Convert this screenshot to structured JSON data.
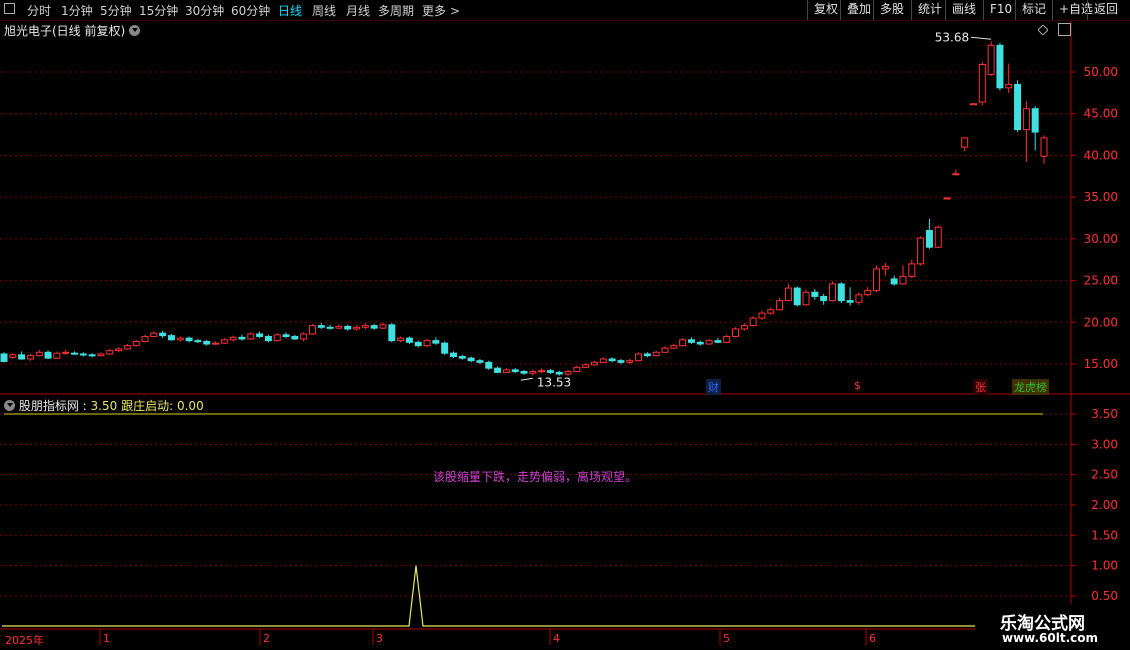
{
  "toolbar": {
    "periods": [
      "分时",
      "1分钟",
      "5分钟",
      "15分钟",
      "30分钟",
      "60分钟",
      "日线",
      "周线",
      "月线",
      "多周期",
      "更多 >"
    ],
    "active_period": "日线",
    "right_buttons": [
      "复权",
      "叠加",
      "多股",
      "统计",
      "画线",
      "F10",
      "标记",
      "+自选",
      "返回"
    ]
  },
  "main": {
    "title": "旭光电子(日线 前复权)",
    "high_label": "53.68",
    "low_label": "13.53",
    "markers": [
      {
        "text": "财",
        "color": "#3060ff"
      },
      {
        "text": "$",
        "color": "#ff3030"
      },
      {
        "text": "张",
        "color": "#ff3030"
      },
      {
        "text": "龙虎榜",
        "color": "#30c030"
      }
    ],
    "y_ticks": [
      "50.00",
      "45.00",
      "40.00",
      "35.00",
      "30.00",
      "25.00",
      "20.00",
      "15.00"
    ]
  },
  "indicator": {
    "name": "股朋指标网",
    "value1": "3.50",
    "label2": "跟庄启动",
    "value2": "0.00",
    "message": "该股缩量下跌，走势偏弱，离场观望。",
    "y_ticks": [
      "3.50",
      "3.00",
      "2.50",
      "2.00",
      "1.50",
      "1.00",
      "0.50"
    ]
  },
  "date_axis": [
    "2025年",
    "1",
    "2",
    "3",
    "4",
    "5",
    "6"
  ],
  "watermark": {
    "line1": "乐淘公式网",
    "line2": "www.60lt.com"
  },
  "colors": {
    "up": "#ff3030",
    "down": "#40e0e0",
    "grid": "#7a0000",
    "line": "#e0d000",
    "signal": "#e8e860"
  },
  "chart_data": {
    "type": "candlestick",
    "series_note": "",
    "high": 53.68,
    "low": 13.53,
    "price_ylim": [
      11,
      57
    ],
    "indicator_ylim": [
      0,
      3.75
    ],
    "candles": [
      [
        16.2,
        15.3,
        16.4,
        15.2
      ],
      [
        15.8,
        16.1,
        16.3,
        15.6
      ],
      [
        16.1,
        15.6,
        16.5,
        15.5
      ],
      [
        15.6,
        16.0,
        16.2,
        15.4
      ],
      [
        16.0,
        16.4,
        16.7,
        15.9
      ],
      [
        16.4,
        15.7,
        16.6,
        15.6
      ],
      [
        15.7,
        16.3,
        16.5,
        15.6
      ],
      [
        16.3,
        16.4,
        16.7,
        16.1
      ],
      [
        16.3,
        16.2,
        16.5,
        16.1
      ],
      [
        16.2,
        16.1,
        16.4,
        15.9
      ],
      [
        16.1,
        16.0,
        16.3,
        15.8
      ],
      [
        16.0,
        16.2,
        16.4,
        15.9
      ],
      [
        16.2,
        16.6,
        16.8,
        16.1
      ],
      [
        16.6,
        16.8,
        17.0,
        16.4
      ],
      [
        16.8,
        17.2,
        17.4,
        16.7
      ],
      [
        17.2,
        17.7,
        17.9,
        17.1
      ],
      [
        17.7,
        18.3,
        18.5,
        17.6
      ],
      [
        18.3,
        18.7,
        18.9,
        18.2
      ],
      [
        18.7,
        18.4,
        19.0,
        18.1
      ],
      [
        18.4,
        17.9,
        18.6,
        17.8
      ],
      [
        17.9,
        18.1,
        18.3,
        17.7
      ],
      [
        18.1,
        17.8,
        18.3,
        17.6
      ],
      [
        17.8,
        17.7,
        18.0,
        17.5
      ],
      [
        17.7,
        17.4,
        17.9,
        17.2
      ],
      [
        17.4,
        17.5,
        17.7,
        17.3
      ],
      [
        17.5,
        17.9,
        18.1,
        17.4
      ],
      [
        17.9,
        18.2,
        18.4,
        17.7
      ],
      [
        18.2,
        18.0,
        18.5,
        17.8
      ],
      [
        18.0,
        18.6,
        18.8,
        17.9
      ],
      [
        18.6,
        18.3,
        18.9,
        18.1
      ],
      [
        18.3,
        17.8,
        18.5,
        17.6
      ],
      [
        17.8,
        18.5,
        18.7,
        17.7
      ],
      [
        18.5,
        18.3,
        18.8,
        18.1
      ],
      [
        18.3,
        18.0,
        18.5,
        17.9
      ],
      [
        18.0,
        18.6,
        18.8,
        17.7
      ],
      [
        18.6,
        19.6,
        19.8,
        18.5
      ],
      [
        19.6,
        19.4,
        19.9,
        19.2
      ],
      [
        19.4,
        19.3,
        19.7,
        19.1
      ],
      [
        19.3,
        19.5,
        19.8,
        19.2
      ],
      [
        19.5,
        19.2,
        19.7,
        19.0
      ],
      [
        19.2,
        19.4,
        19.6,
        19.0
      ],
      [
        19.4,
        19.6,
        19.9,
        19.2
      ],
      [
        19.6,
        19.3,
        19.8,
        19.1
      ],
      [
        19.3,
        19.7,
        20.0,
        19.2
      ],
      [
        19.7,
        17.8,
        19.9,
        17.6
      ],
      [
        17.8,
        18.1,
        18.3,
        17.6
      ],
      [
        18.1,
        17.6,
        18.3,
        17.4
      ],
      [
        17.6,
        17.2,
        17.8,
        17.0
      ],
      [
        17.2,
        17.8,
        18.0,
        17.0
      ],
      [
        17.8,
        17.5,
        18.2,
        17.3
      ],
      [
        17.5,
        16.3,
        17.7,
        16.1
      ],
      [
        16.3,
        15.9,
        16.5,
        15.7
      ],
      [
        15.9,
        15.7,
        16.1,
        15.5
      ],
      [
        15.7,
        15.4,
        15.9,
        15.2
      ],
      [
        15.4,
        15.2,
        15.6,
        15.0
      ],
      [
        15.2,
        14.5,
        15.4,
        14.3
      ],
      [
        14.5,
        14.0,
        14.7,
        13.9
      ],
      [
        14.0,
        14.3,
        14.5,
        13.9
      ],
      [
        14.3,
        14.1,
        14.5,
        13.9
      ],
      [
        14.1,
        13.9,
        14.3,
        13.7
      ],
      [
        13.9,
        14.1,
        14.3,
        13.6
      ],
      [
        14.1,
        14.2,
        14.5,
        13.9
      ],
      [
        14.2,
        14.0,
        14.4,
        13.8
      ],
      [
        14.0,
        13.8,
        14.2,
        13.6
      ],
      [
        13.8,
        14.1,
        14.3,
        13.6
      ],
      [
        14.1,
        14.6,
        14.8,
        14.0
      ],
      [
        14.6,
        14.9,
        15.1,
        14.5
      ],
      [
        14.9,
        15.2,
        15.4,
        14.8
      ],
      [
        15.2,
        15.6,
        15.8,
        15.1
      ],
      [
        15.6,
        15.4,
        15.8,
        15.2
      ],
      [
        15.4,
        15.2,
        15.6,
        15.0
      ],
      [
        15.2,
        15.4,
        15.6,
        15.0
      ],
      [
        15.4,
        16.2,
        16.4,
        15.3
      ],
      [
        16.2,
        16.0,
        16.4,
        15.8
      ],
      [
        16.0,
        16.4,
        16.6,
        15.9
      ],
      [
        16.4,
        16.9,
        17.1,
        16.3
      ],
      [
        16.9,
        17.2,
        17.4,
        16.8
      ],
      [
        17.2,
        17.9,
        18.1,
        17.1
      ],
      [
        17.9,
        17.6,
        18.2,
        17.4
      ],
      [
        17.6,
        17.4,
        17.8,
        17.2
      ],
      [
        17.4,
        17.8,
        18.0,
        17.3
      ],
      [
        17.8,
        17.6,
        18.1,
        17.5
      ],
      [
        17.6,
        18.3,
        18.5,
        17.5
      ],
      [
        18.3,
        19.2,
        19.4,
        18.2
      ],
      [
        19.2,
        19.6,
        19.9,
        19.0
      ],
      [
        19.6,
        20.5,
        20.7,
        19.5
      ],
      [
        20.5,
        21.1,
        21.4,
        20.3
      ],
      [
        21.1,
        21.5,
        21.8,
        20.9
      ],
      [
        21.5,
        22.6,
        22.9,
        21.4
      ],
      [
        22.6,
        24.1,
        24.6,
        22.5
      ],
      [
        24.1,
        22.1,
        24.3,
        21.9
      ],
      [
        22.1,
        23.6,
        23.9,
        22.0
      ],
      [
        23.6,
        23.1,
        24.0,
        22.7
      ],
      [
        23.1,
        22.6,
        23.4,
        22.1
      ],
      [
        22.6,
        24.6,
        24.9,
        22.5
      ],
      [
        24.6,
        22.6,
        24.8,
        22.3
      ],
      [
        22.6,
        22.4,
        24.2,
        22.0
      ],
      [
        22.4,
        23.3,
        23.6,
        22.1
      ],
      [
        23.3,
        23.8,
        24.2,
        23.1
      ],
      [
        23.8,
        26.4,
        26.8,
        23.6
      ],
      [
        26.4,
        26.7,
        27.1,
        25.6
      ],
      [
        25.2,
        24.6,
        25.6,
        24.4
      ],
      [
        24.6,
        25.5,
        26.8,
        24.5
      ],
      [
        25.5,
        27.0,
        27.5,
        25.3
      ],
      [
        27.0,
        30.1,
        30.3,
        26.8
      ],
      [
        31.0,
        29.0,
        32.4,
        28.8
      ],
      [
        29.0,
        31.4,
        31.6,
        28.9
      ],
      [
        34.9,
        34.9,
        34.9,
        34.9
      ],
      [
        37.8,
        37.8,
        38.3,
        37.8
      ],
      [
        41.0,
        42.1,
        42.1,
        40.5
      ],
      [
        46.2,
        46.2,
        46.2,
        46.2
      ],
      [
        46.4,
        50.9,
        51.2,
        46.0
      ],
      [
        49.7,
        53.2,
        53.68,
        49.5
      ],
      [
        53.2,
        48.1,
        53.5,
        47.8
      ],
      [
        48.1,
        48.5,
        51.0,
        47.5
      ],
      [
        48.5,
        43.1,
        49.0,
        42.8
      ],
      [
        43.1,
        45.6,
        46.5,
        39.2
      ],
      [
        45.6,
        42.8,
        45.9,
        40.6
      ],
      [
        39.9,
        42.1,
        42.4,
        39.0
      ]
    ],
    "indicator_values": [
      0,
      0,
      0,
      0,
      0,
      0,
      0,
      0,
      0,
      0,
      0,
      0,
      0,
      0,
      0,
      0,
      0,
      0,
      0,
      0,
      0,
      0,
      0,
      0,
      0,
      0,
      0,
      0,
      0,
      0,
      0,
      0,
      0,
      0,
      0,
      0,
      0,
      0,
      0,
      0,
      0,
      0,
      0,
      0,
      0,
      0,
      0,
      0,
      0,
      0,
      0,
      0,
      0,
      0,
      0,
      0,
      0,
      0,
      0,
      0,
      0,
      0,
      0,
      0,
      0,
      0,
      0,
      0,
      0,
      0,
      0,
      0,
      0,
      0,
      0,
      0,
      0,
      0,
      0,
      0,
      0,
      0,
      0,
      0,
      0,
      0,
      0,
      0,
      0,
      0,
      0,
      0,
      0,
      0,
      0,
      0,
      0,
      0,
      0,
      0,
      0,
      0,
      0,
      0,
      0,
      0,
      0,
      0,
      0,
      0,
      0,
      0,
      0,
      0,
      0,
      0,
      0,
      0,
      0,
      0,
      0,
      0,
      0,
      0,
      0,
      0,
      0,
      0,
      0,
      0,
      0,
      0,
      0,
      0,
      0,
      0,
      0,
      0,
      0,
      0,
      0,
      0,
      0,
      0,
      0,
      0,
      0,
      0,
      0,
      0,
      0,
      0
    ],
    "indicator_spike": {
      "date_index": 0,
      "value": 1.0
    },
    "indicator_level": 3.5,
    "title": "",
    "xlabel": "",
    "ylabel": ""
  }
}
